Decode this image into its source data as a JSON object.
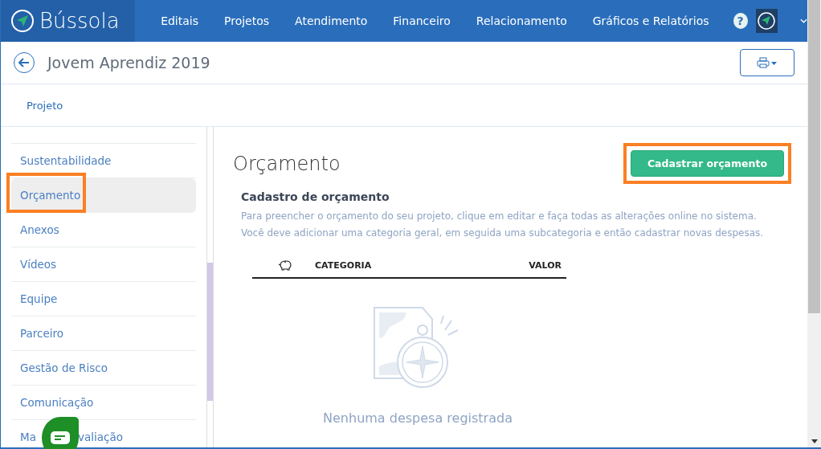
{
  "nav": {
    "brand": "Bússola",
    "items": [
      "Editais",
      "Projetos",
      "Atendimento",
      "Financeiro",
      "Relacionamento",
      "Gráficos e Relatórios"
    ],
    "help": "?"
  },
  "header": {
    "title": "Jovem Aprendiz 2019"
  },
  "tabs": [
    {
      "label": "Projeto",
      "selected": false
    }
  ],
  "sidebar": {
    "items": [
      {
        "label": "Sustentabilidade",
        "selected": false,
        "highlighted": false
      },
      {
        "label": "Orçamento",
        "selected": true,
        "highlighted": true
      },
      {
        "label": "Anexos",
        "selected": false,
        "highlighted": false
      },
      {
        "label": "Vídeos",
        "selected": false,
        "highlighted": false
      },
      {
        "label": "Equipe",
        "selected": false,
        "highlighted": false
      },
      {
        "label": "Parceiro",
        "selected": false,
        "highlighted": false
      },
      {
        "label": "Gestão de Risco",
        "selected": false,
        "highlighted": false
      },
      {
        "label": "Comunicação",
        "selected": false,
        "highlighted": false
      },
      {
        "visible_parts": [
          "Ma",
          "valiação"
        ],
        "selected": false,
        "highlighted": false
      }
    ]
  },
  "main": {
    "title": "Orçamento",
    "action": {
      "label": "Cadastrar orçamento",
      "highlighted": true
    },
    "section_title": "Cadastro de orçamento",
    "description": [
      "Para preencher o orçamento do seu projeto, clique em editar e faça todas as alterações online no sistema.",
      "Você deve adicionar uma categoria geral, em seguida uma subcategoria e então cadastrar novas despesas."
    ],
    "table": {
      "columns": [
        "CATEGORIA",
        "VALOR"
      ]
    },
    "empty_text": "Nenhuma despesa registrada"
  }
}
